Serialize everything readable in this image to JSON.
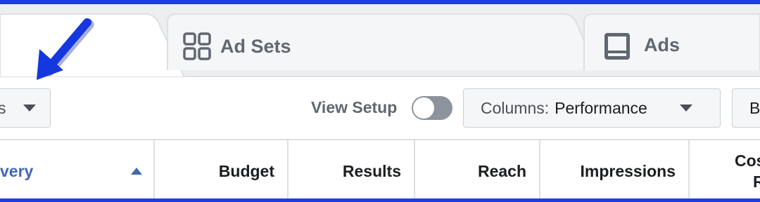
{
  "tabs": [
    {
      "label": "Ad Sets",
      "icon": "grid-icon"
    },
    {
      "label": "Ads",
      "icon": "ad-window-icon"
    }
  ],
  "toolbar": {
    "filter_label": "s",
    "view_setup_label": "View Setup",
    "view_setup_on": false,
    "columns_prefix": "Columns:",
    "columns_value": "Performance",
    "breakdown_label": "B"
  },
  "table": {
    "headers": [
      "very",
      "Budget",
      "Results",
      "Reach",
      "Impressions",
      "Cos"
    ],
    "header_extra": "R",
    "sorted_column": "very",
    "sort_direction": "ascending"
  },
  "colors": {
    "frame": "#1a3de6",
    "annotation_arrow": "#1437e0",
    "link_blue": "#4267b2"
  }
}
